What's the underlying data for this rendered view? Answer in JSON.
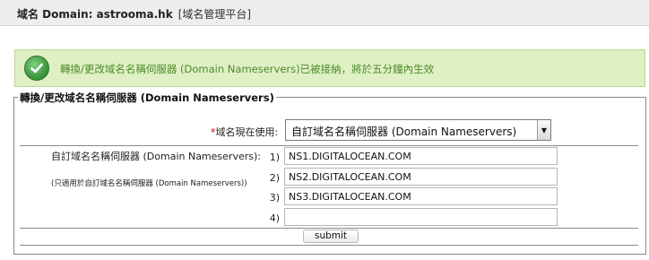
{
  "header": {
    "domain_label": "域名 Domain: astrooma.hk",
    "platform_label": "[域名管理平台]"
  },
  "alert": {
    "icon": "checkmark-circle-icon",
    "message": "轉換/更改域名名稱伺服器 (Domain Nameservers)已被接納，將於五分鐘內生效",
    "color": "#4d8a2a",
    "background": "#dff0c5"
  },
  "form": {
    "legend": "轉換/更改域名名稱伺服器 (Domain Nameservers)",
    "current_use": {
      "label_required_mark": "*",
      "label": "域名現在使用:",
      "selected": "自訂域名名稱伺服器 (Domain Nameservers)"
    },
    "custom_ns": {
      "label": "自訂域名名稱伺服器 (Domain Nameservers):",
      "note": "(只適用於自訂域名名稱伺服器 (Domain Nameservers))",
      "entries": [
        {
          "num": "1)",
          "value": "NS1.DIGITALOCEAN.COM"
        },
        {
          "num": "2)",
          "value": "NS2.DIGITALOCEAN.COM"
        },
        {
          "num": "3)",
          "value": "NS3.DIGITALOCEAN.COM"
        },
        {
          "num": "4)",
          "value": ""
        }
      ]
    },
    "submit_label": "submit"
  }
}
